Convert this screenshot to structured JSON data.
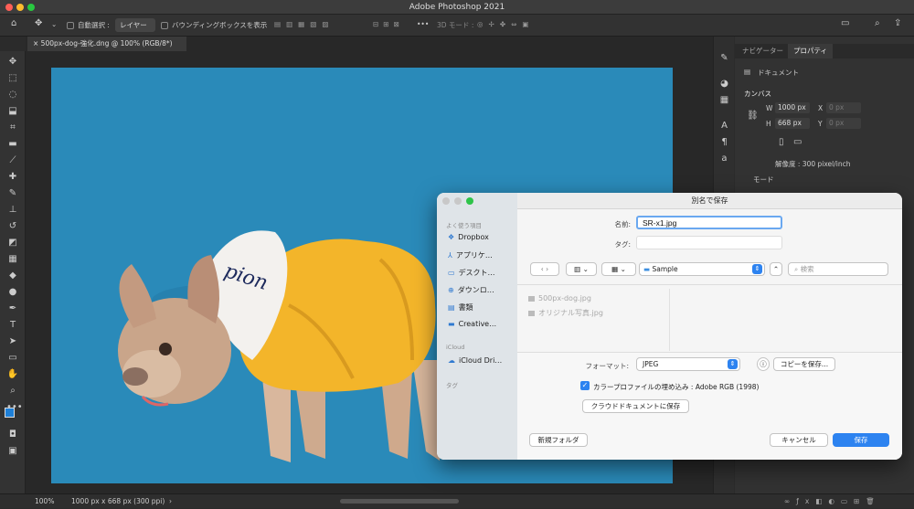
{
  "app": {
    "title": "Adobe Photoshop 2021"
  },
  "options_bar": {
    "auto_select_label": "自動選択 :",
    "layer_select": "レイヤー",
    "bbox_label": "バウンディングボックスを表示",
    "mode_3d": "3D モード :"
  },
  "document": {
    "tab_title": "500px-dog-強化.dng @ 100% (RGB/8*)"
  },
  "status": {
    "zoom": "100%",
    "doc_info": "1000 px x 668 px (300 ppi)"
  },
  "panel": {
    "tabs": [
      "ナビゲーター",
      "プロパティ"
    ],
    "doc_label": "ドキュメント",
    "canvas_heading": "カンバス",
    "w_label": "W",
    "w_value": "1000 px",
    "h_label": "H",
    "h_value": "668 px",
    "x_label": "X",
    "x_value": "0 px",
    "y_label": "Y",
    "y_value": "0 px",
    "resolution": "解像度 : 300 pixel/inch",
    "mode_label": "モード"
  },
  "dialog": {
    "title": "別名で保存",
    "sidebar": {
      "favorites_header": "よく使う項目",
      "favorites": [
        "Dropbox",
        "アプリケ…",
        "デスクト…",
        "ダウンロ…",
        "書類",
        "Creative…"
      ],
      "icloud_header": "iCloud",
      "icloud_items": [
        "iCloud Dri…"
      ],
      "tags_header": "タグ"
    },
    "name_label": "名前:",
    "name_value": "SR-x1.jpg",
    "tag_label": "タグ:",
    "tag_value": "",
    "folder": "Sample",
    "search_placeholder": "検索",
    "files": [
      "500px-dog.jpg",
      "オリジナル写真.jpg"
    ],
    "format_label": "フォーマット:",
    "format_value": "JPEG",
    "save_copy_button": "コピーを保存...",
    "color_profile_label": "カラープロファイルの埋め込み : Adobe RGB (1998)",
    "color_profile_checked": true,
    "cloud_save_button": "クラウドドキュメントに保存",
    "new_folder_button": "新規フォルダ",
    "cancel_button": "キャンセル",
    "save_button": "保存"
  },
  "colors": {
    "accent": "#2d83f0",
    "canvas_bg": "#2a8ab9",
    "hoodie": "#f3b52a"
  }
}
